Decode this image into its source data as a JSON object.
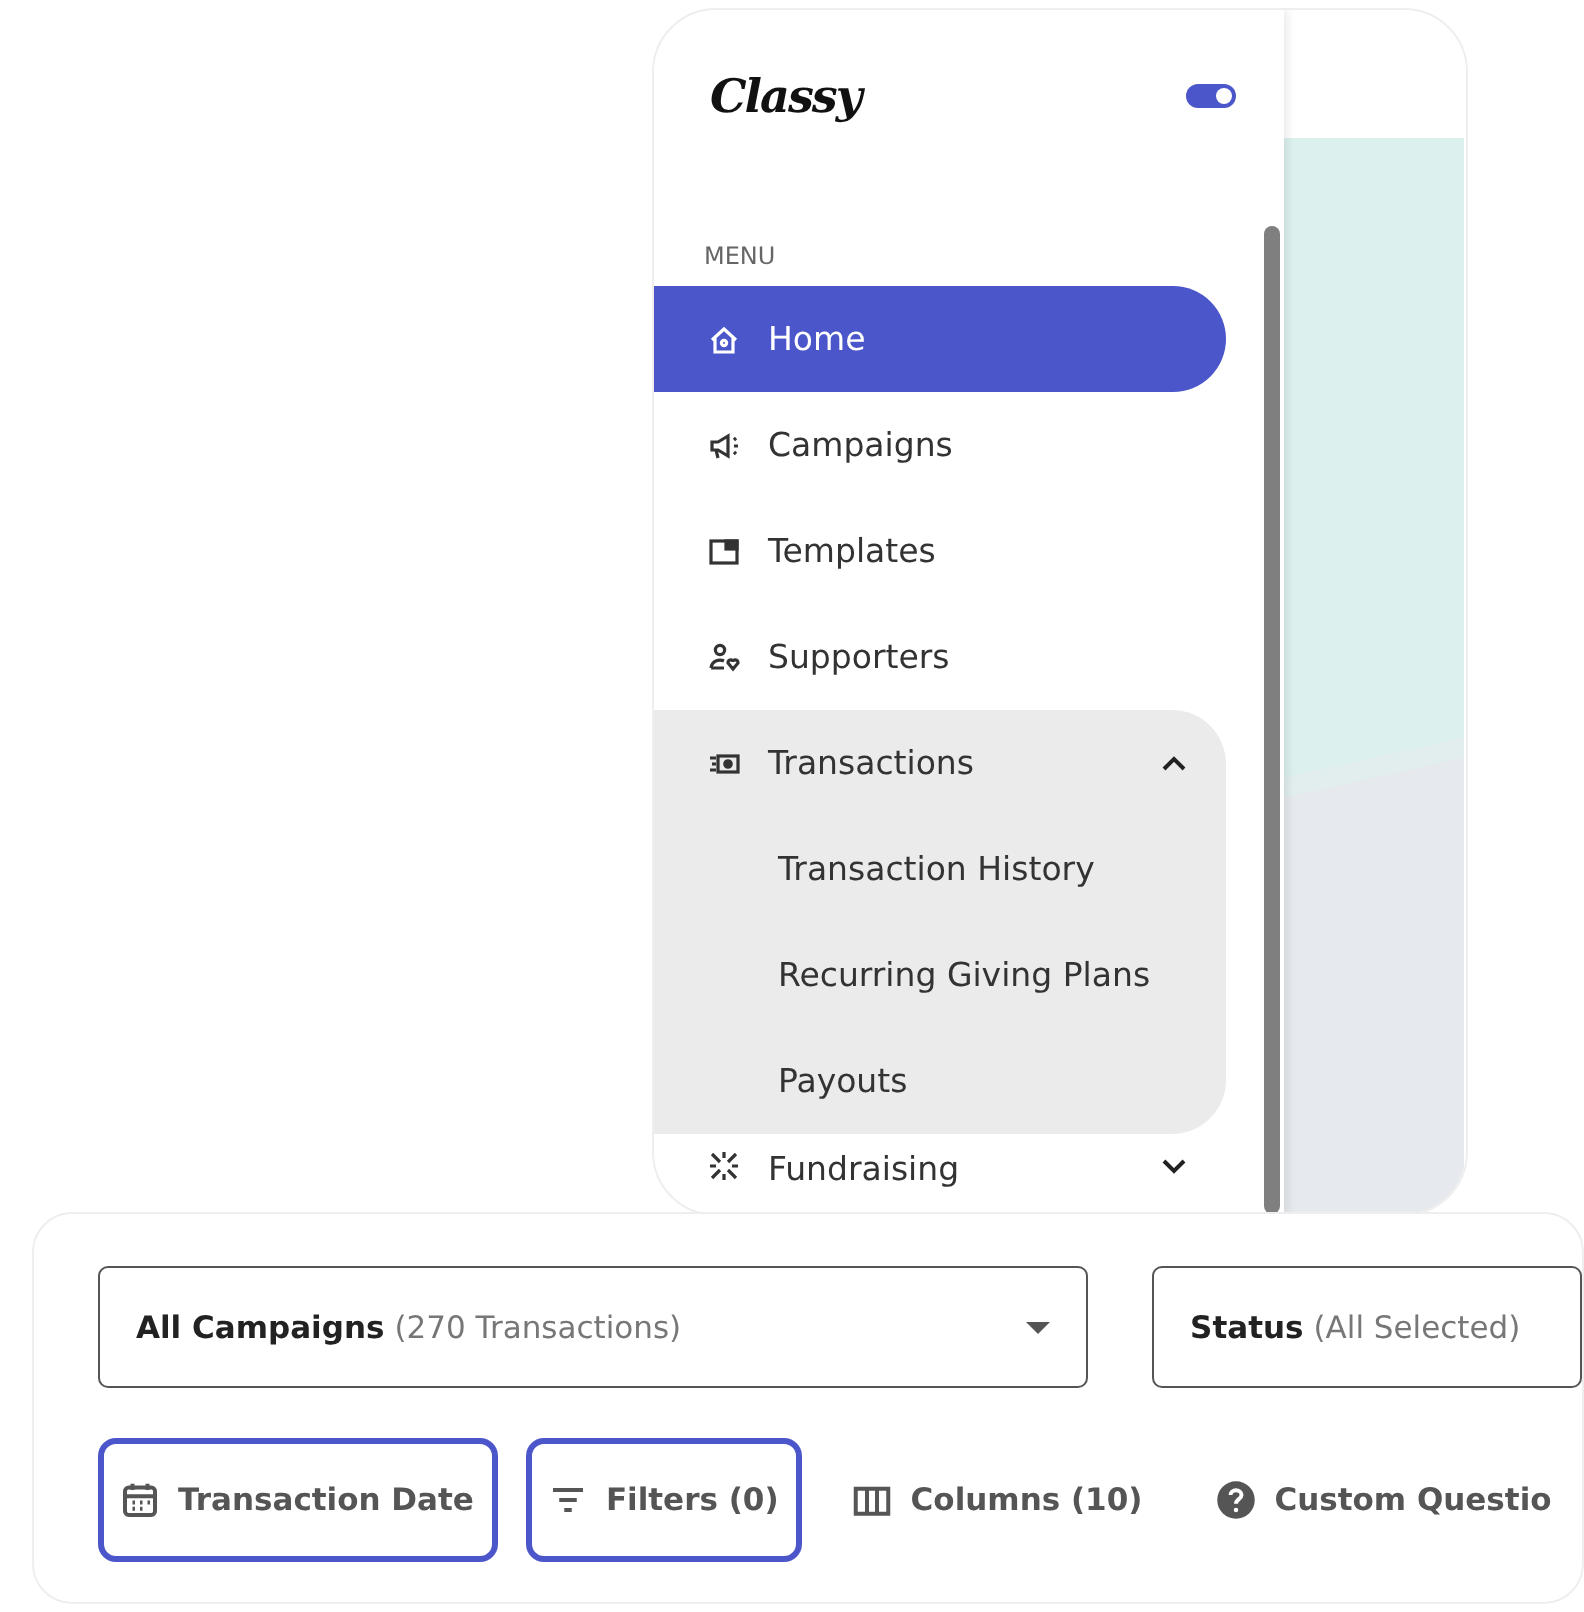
{
  "sidebar": {
    "logo": "Classy",
    "toggle": {
      "on": true
    },
    "section_label": "MENU",
    "items": [
      {
        "label": "Home",
        "selected": true
      },
      {
        "label": "Campaigns",
        "selected": false
      },
      {
        "label": "Templates",
        "selected": false
      },
      {
        "label": "Supporters",
        "selected": false
      },
      {
        "label": "Transactions",
        "selected": false,
        "expanded": true,
        "children": [
          {
            "label": "Transaction History",
            "selected": false
          },
          {
            "label": "Recurring Giving Plans",
            "selected": false
          },
          {
            "label": "Payouts",
            "selected": false
          }
        ]
      },
      {
        "label": "Fundraising",
        "selected": false,
        "expanded": false
      }
    ]
  },
  "filters": {
    "dropdowns": [
      {
        "label": "All Campaigns",
        "detail": "(270 Transactions)",
        "caret": true
      },
      {
        "label": "Status",
        "detail": "(All Selected)",
        "caret": false
      }
    ],
    "toolbar": [
      {
        "label": "Transaction Date",
        "highlighted": true
      },
      {
        "label": "Filters (0)",
        "highlighted": true
      },
      {
        "label": "Columns (10)",
        "highlighted": false
      },
      {
        "label": "Custom Questio",
        "highlighted": false
      }
    ]
  }
}
